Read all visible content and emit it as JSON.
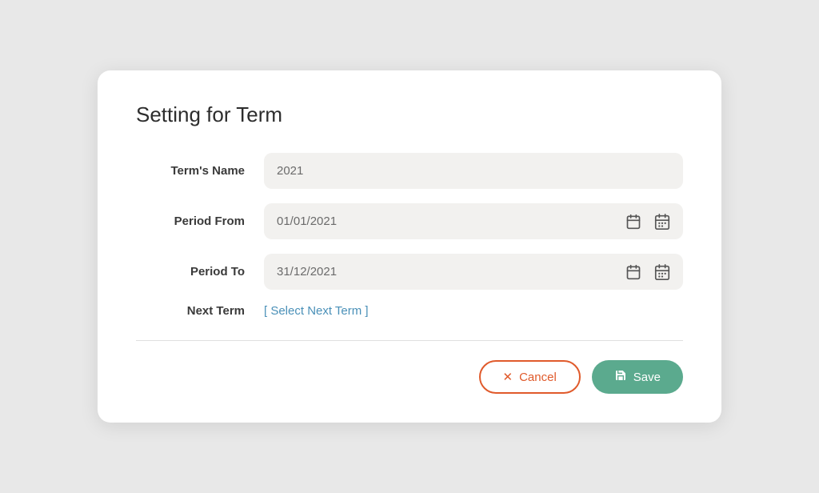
{
  "modal": {
    "title": "Setting for Term",
    "fields": {
      "term_name": {
        "label": "Term's Name",
        "value": "2021",
        "placeholder": "2021"
      },
      "period_from": {
        "label": "Period From",
        "value": "01/01/2021"
      },
      "period_to": {
        "label": "Period To",
        "value": "31/12/2021"
      },
      "next_term": {
        "label": "Next Term",
        "link_text": "[ Select Next Term ]"
      }
    },
    "buttons": {
      "cancel_label": "Cancel",
      "save_label": "Save"
    }
  }
}
